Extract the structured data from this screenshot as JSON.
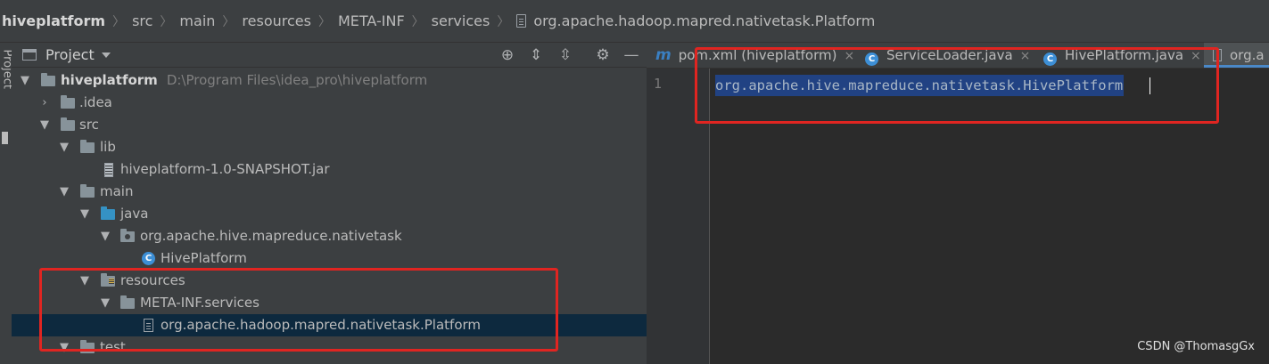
{
  "breadcrumb": [
    "hiveplatform",
    "src",
    "main",
    "resources",
    "META-INF",
    "services",
    "org.apache.hadoop.mapred.nativetask.Platform"
  ],
  "sidebar_stripe_label": "Project",
  "project_panel": {
    "title": "Project",
    "tree": [
      {
        "label": "hiveplatform",
        "path": "D:\\Program Files\\idea_pro\\hiveplatform"
      },
      {
        "label": ".idea"
      },
      {
        "label": "src"
      },
      {
        "label": "lib"
      },
      {
        "label": "hiveplatform-1.0-SNAPSHOT.jar"
      },
      {
        "label": "main"
      },
      {
        "label": "java"
      },
      {
        "label": "org.apache.hive.mapreduce.nativetask"
      },
      {
        "label": "HivePlatform"
      },
      {
        "label": "resources"
      },
      {
        "label": "META-INF.services"
      },
      {
        "label": "org.apache.hadoop.mapred.nativetask.Platform"
      },
      {
        "label": "test"
      }
    ]
  },
  "editor": {
    "tabs": [
      {
        "label": "pom.xml (hiveplatform)",
        "icon": "maven-icon"
      },
      {
        "label": "ServiceLoader.java",
        "icon": "class-icon"
      },
      {
        "label": "HivePlatform.java",
        "icon": "class-icon"
      },
      {
        "label": "org.a",
        "icon": "file-icon"
      }
    ],
    "close_glyph": "×",
    "class_glyph": "C",
    "maven_glyph": "m",
    "line_number": "1",
    "code": "org.apache.hive.mapreduce.nativetask.HivePlatform"
  },
  "colors": {
    "highlight_box": "#e02521",
    "selection": "#214283",
    "tree_selected": "#0d293e"
  },
  "watermark": "CSDN @ThomasgGx"
}
